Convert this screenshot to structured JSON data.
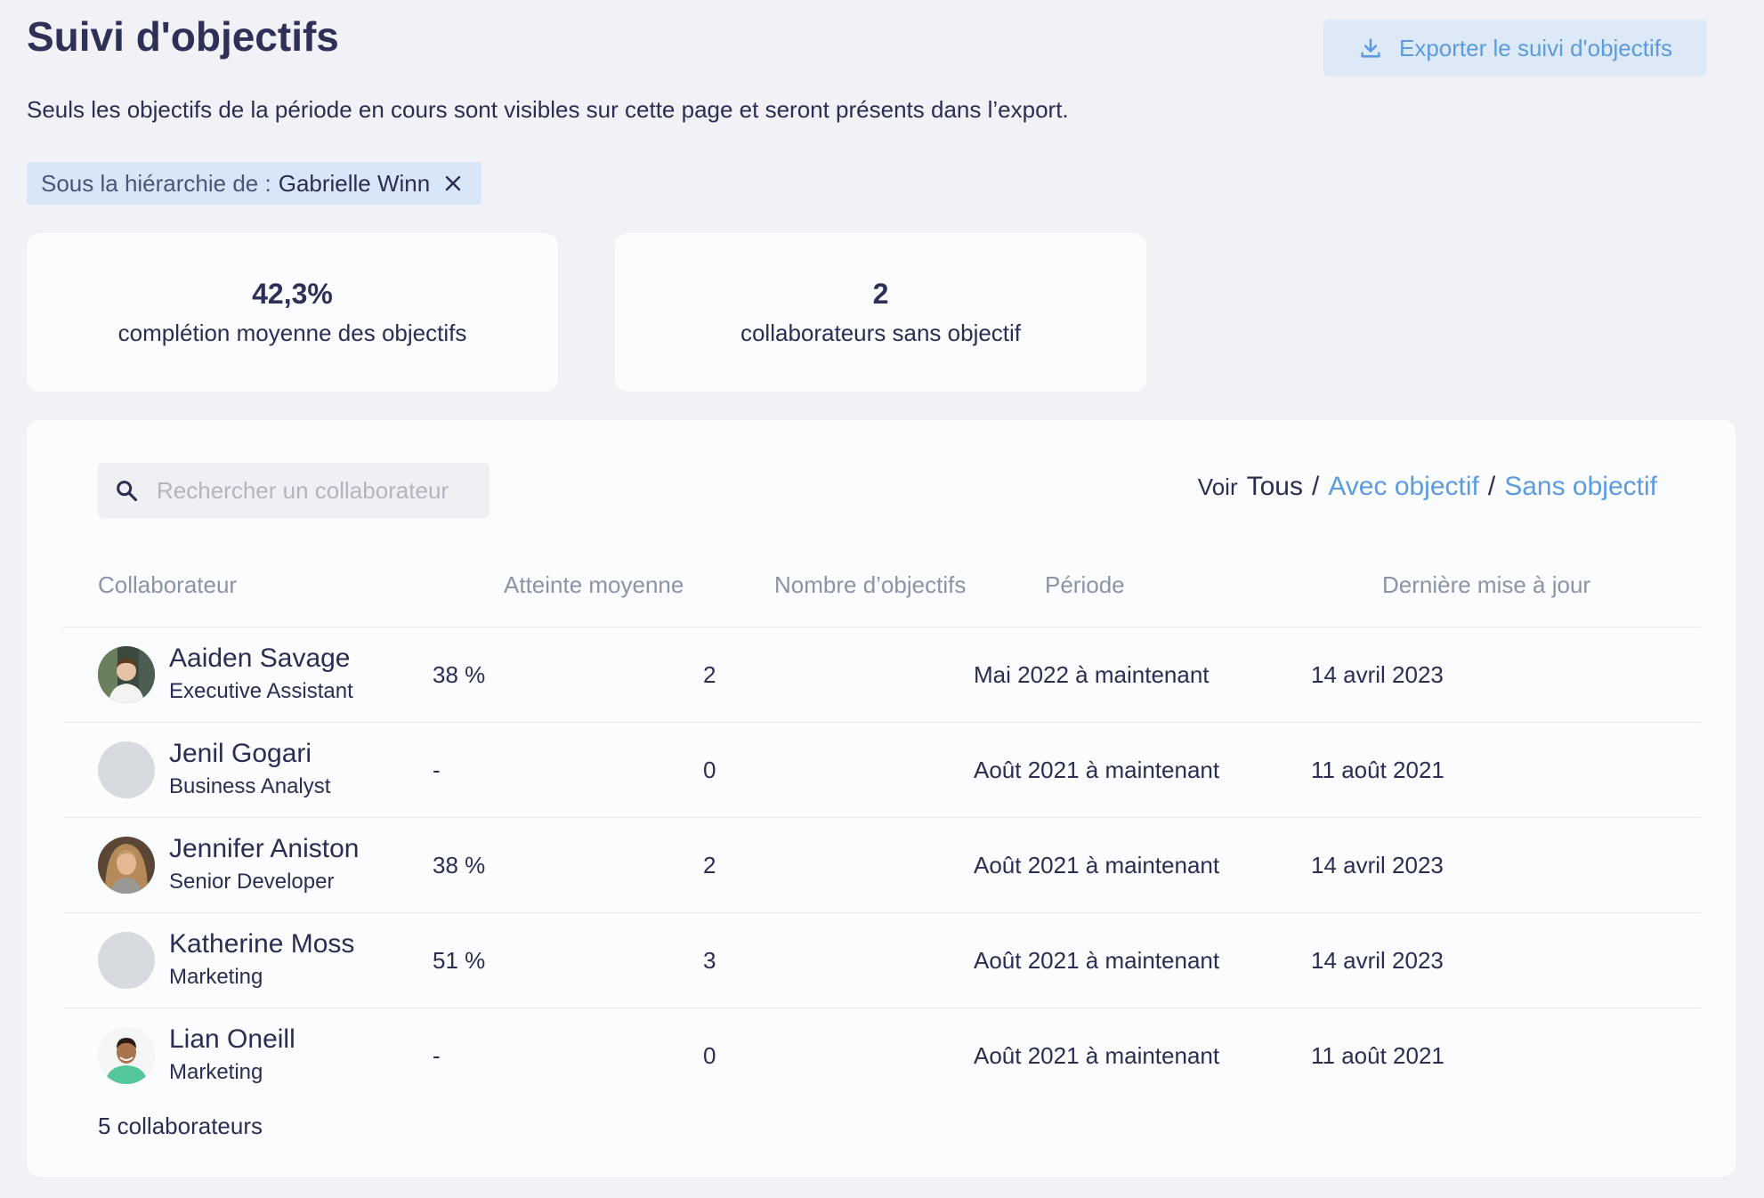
{
  "header": {
    "title": "Suivi d'objectifs",
    "export_label": "Exporter le suivi d'objectifs",
    "subtitle": "Seuls les objectifs de la période en cours sont visibles sur cette page et seront présents dans l’export."
  },
  "filter_chip": {
    "prefix": "Sous la hiérarchie de :",
    "value": "Gabrielle Winn"
  },
  "stats": [
    {
      "value": "42,3%",
      "label": "complétion moyenne des objectifs"
    },
    {
      "value": "2",
      "label": "collaborateurs sans objectif"
    }
  ],
  "search": {
    "placeholder": "Rechercher un collaborateur"
  },
  "view_filter": {
    "label": "Voir",
    "options": [
      "Tous",
      "Avec objectif",
      "Sans objectif"
    ],
    "separator": "/",
    "active": "Tous"
  },
  "table": {
    "columns": [
      "Collaborateur",
      "Atteinte moyenne",
      "Nombre d’objectifs",
      "Période",
      "Dernière mise à jour"
    ],
    "rows": [
      {
        "name": "Aaiden Savage",
        "role": "Executive Assistant",
        "attainment": "38 %",
        "count": "2",
        "period": "Mai 2022 à maintenant",
        "updated": "14 avril 2023",
        "avatar": "photo-man-white-shirt"
      },
      {
        "name": "Jenil Gogari",
        "role": "Business Analyst",
        "attainment": "-",
        "count": "0",
        "period": "Août 2021 à maintenant",
        "updated": "11 août 2021",
        "avatar": "placeholder"
      },
      {
        "name": "Jennifer Aniston",
        "role": "Senior Developer",
        "attainment": "38 %",
        "count": "2",
        "period": "Août 2021 à maintenant",
        "updated": "14 avril 2023",
        "avatar": "photo-woman-blonde"
      },
      {
        "name": "Katherine Moss",
        "role": "Marketing",
        "attainment": "51 %",
        "count": "3",
        "period": "Août 2021 à maintenant",
        "updated": "14 avril 2023",
        "avatar": "placeholder"
      },
      {
        "name": "Lian Oneill",
        "role": "Marketing",
        "attainment": "-",
        "count": "0",
        "period": "Août 2021 à maintenant",
        "updated": "11 août 2021",
        "avatar": "photo-man-green-shirt"
      }
    ]
  },
  "footer": {
    "count_label": "5 collaborateurs"
  },
  "colors": {
    "accent": "#5b9bde",
    "background": "#f1f2f6",
    "card": "#fbfcfd",
    "text": "#2b2d52",
    "muted": "#8b93a7"
  }
}
